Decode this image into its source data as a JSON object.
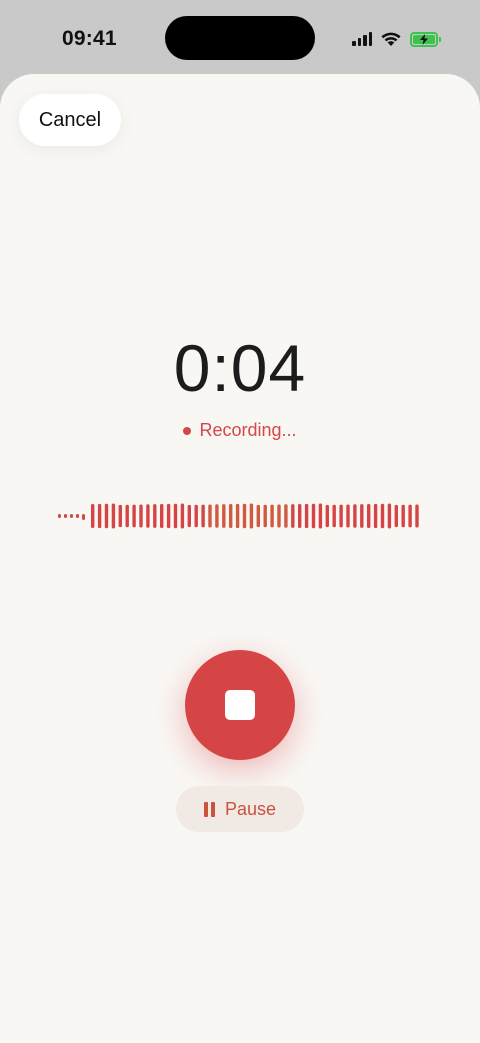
{
  "status_bar": {
    "time": "09:41",
    "icons": [
      "cellular-signal-icon",
      "wifi-icon",
      "battery-charging-icon"
    ],
    "battery_color": "#3cc24e"
  },
  "sheet": {
    "cancel_label": "Cancel"
  },
  "recorder": {
    "elapsed": "0:04",
    "status_label": "Recording...",
    "accent_color": "#d64545",
    "stop_icon": "stop-icon",
    "pause_label": "Pause",
    "pause_icon": "pause-icon"
  }
}
